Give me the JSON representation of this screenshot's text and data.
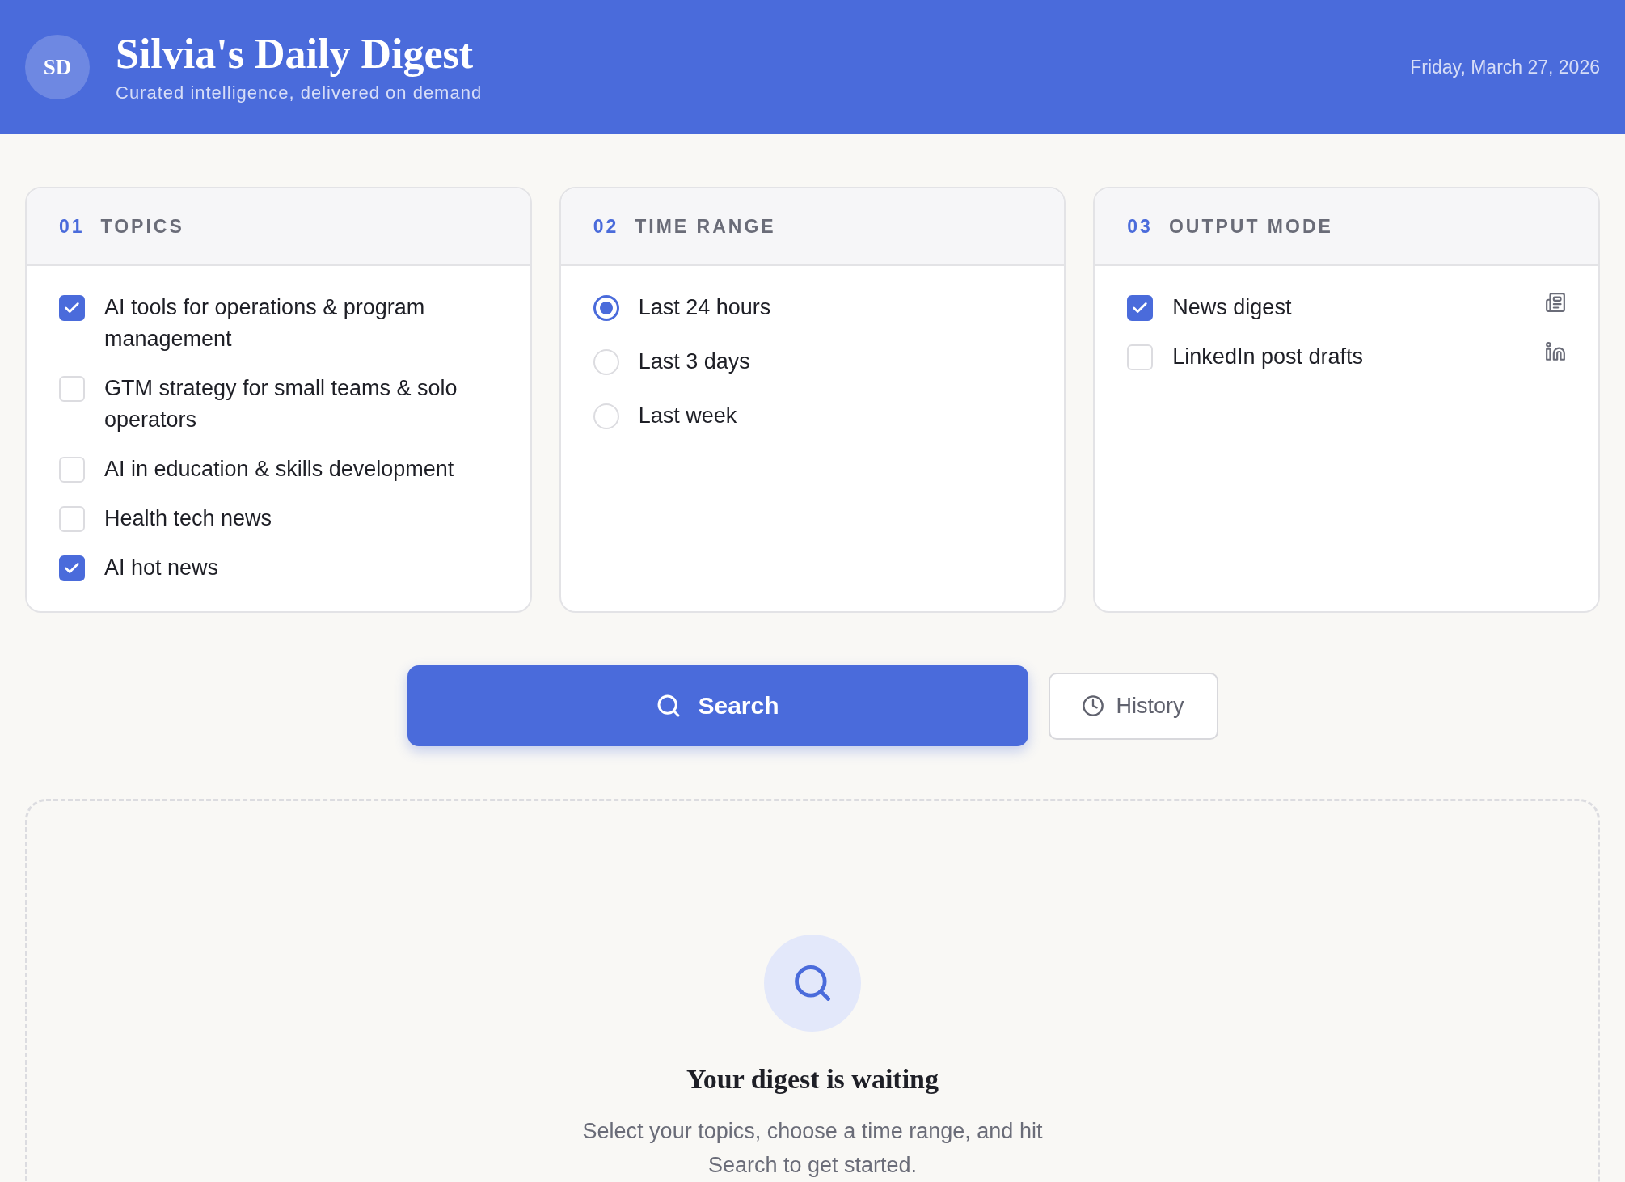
{
  "header": {
    "avatar": "SD",
    "title": "Silvia's Daily Digest",
    "subtitle": "Curated intelligence, delivered on demand",
    "date": "Friday, March 27, 2026"
  },
  "panels": [
    {
      "number": "01",
      "title": "TOPICS",
      "kind": "checkbox",
      "items": [
        {
          "label": "AI tools for operations & program management",
          "selected": true
        },
        {
          "label": "GTM strategy for small teams & solo operators",
          "selected": false
        },
        {
          "label": "AI in education & skills development",
          "selected": false
        },
        {
          "label": "Health tech news",
          "selected": false
        },
        {
          "label": "AI hot news",
          "selected": true
        }
      ]
    },
    {
      "number": "02",
      "title": "TIME RANGE",
      "kind": "radio",
      "items": [
        {
          "label": "Last 24 hours",
          "selected": true
        },
        {
          "label": "Last 3 days",
          "selected": false
        },
        {
          "label": "Last week",
          "selected": false
        }
      ]
    },
    {
      "number": "03",
      "title": "OUTPUT MODE",
      "kind": "checkbox",
      "items": [
        {
          "label": "News digest",
          "selected": true
        },
        {
          "label": "LinkedIn post drafts",
          "selected": false
        }
      ]
    }
  ],
  "actions": {
    "search": "Search",
    "history": "History"
  },
  "empty_state": {
    "title": "Your digest is waiting",
    "text": "Select your topics, choose a time range, and hit Search to get started."
  }
}
